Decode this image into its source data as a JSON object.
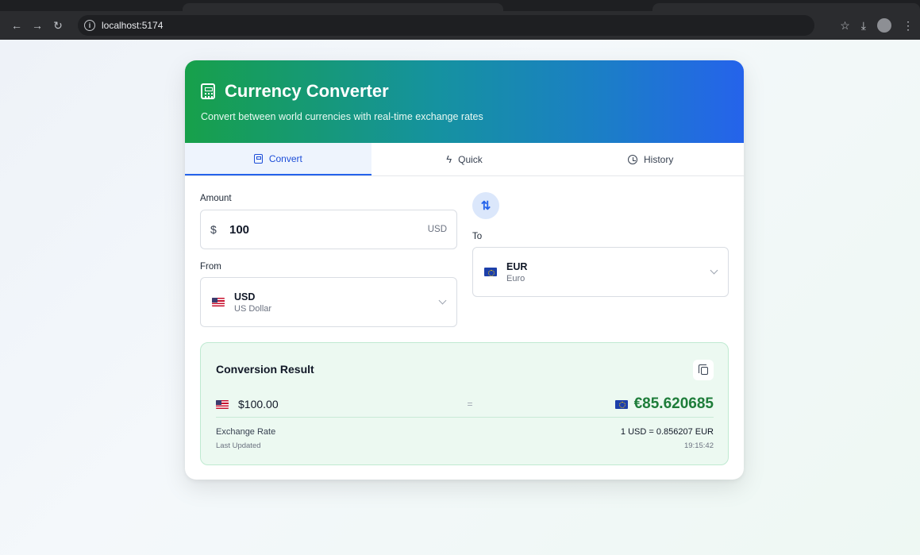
{
  "browser": {
    "url": "localhost:5174"
  },
  "header": {
    "title": "Currency Converter",
    "subtitle": "Convert between world currencies with real-time exchange rates"
  },
  "tabs": [
    {
      "label": "Convert",
      "icon": "calculator-icon",
      "active": true
    },
    {
      "label": "Quick",
      "icon": "lightning-icon",
      "active": false
    },
    {
      "label": "History",
      "icon": "history-icon",
      "active": false
    }
  ],
  "form": {
    "amount_label": "Amount",
    "amount_symbol": "$",
    "amount_value": "100",
    "amount_code": "USD",
    "from_label": "From",
    "from": {
      "code": "USD",
      "name": "US Dollar",
      "flag": "us-flag-icon"
    },
    "to_label": "To",
    "to": {
      "code": "EUR",
      "name": "Euro",
      "flag": "eu-flag-icon"
    },
    "swap_icon": "swap-arrows-icon"
  },
  "result": {
    "title": "Conversion Result",
    "source_amount": "$100.00",
    "equals": "=",
    "target_amount": "€85.620685",
    "rate_label": "Exchange Rate",
    "rate_value": "1 USD = 0.856207 EUR",
    "updated_label": "Last Updated",
    "updated_value": "19:15:42"
  },
  "colors": {
    "accent": "#2563eb",
    "success": "#1e7d3a",
    "header_start": "#17a04a",
    "header_end": "#2563eb"
  }
}
